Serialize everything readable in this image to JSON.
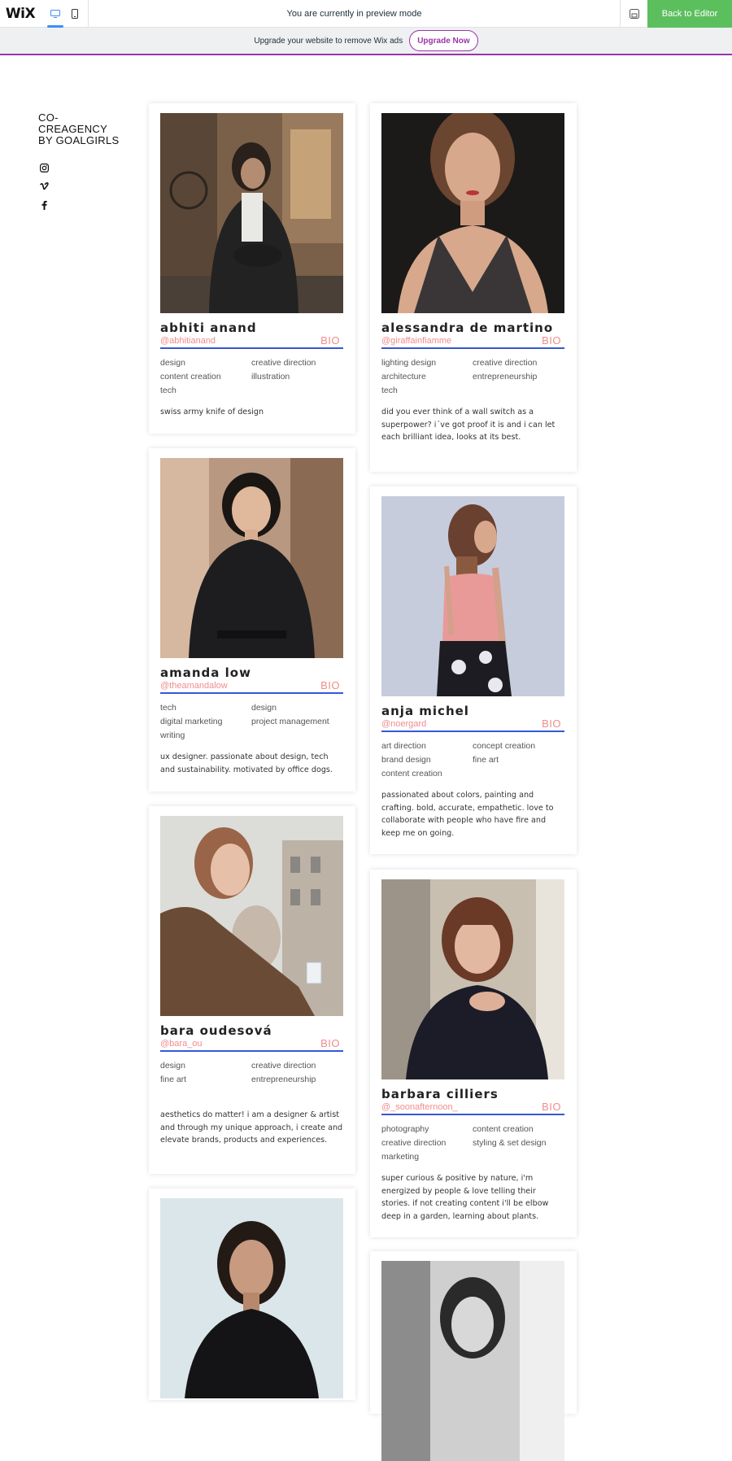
{
  "wix_bar": {
    "logo": "WiX",
    "preview_message": "You are currently in preview mode",
    "back_button": "Back to Editor",
    "upgrade_text": "Upgrade your website to remove Wix ads",
    "upgrade_button": "Upgrade Now",
    "colors": {
      "accent": "#9b35a8",
      "green": "#5cbf5e",
      "blue": "#3b8df7"
    }
  },
  "site": {
    "brand_lines": [
      "CO-",
      "CREAGENCY",
      "BY GOALGIRLS"
    ],
    "social_icons": [
      "instagram-icon",
      "vimeo-icon",
      "facebook-icon"
    ]
  },
  "colors": {
    "handle": "#f08c8c",
    "underline": "#3558d6"
  },
  "members": [
    {
      "name": "abhiti anand",
      "handle": "@abhitianand",
      "bio": "BIO",
      "tags": [
        "design",
        "creative direction",
        "content creation",
        "illustration",
        "tech"
      ],
      "description": "swiss army knife of design"
    },
    {
      "name": "alessandra de martino",
      "handle": "@giraffainfiamme",
      "bio": "BIO",
      "tags": [
        "lighting design",
        "creative direction",
        "architecture",
        "entrepreneurship",
        "tech"
      ],
      "description": "did you ever think of a wall switch as a superpower? i´ve got proof it is and i can let each brilliant idea, looks at its best."
    },
    {
      "name": "amanda low",
      "handle": "@theamandalow",
      "bio": "BIO",
      "tags": [
        "tech",
        "design",
        "digital marketing",
        "project management",
        "writing"
      ],
      "description": "ux designer. passionate about design, tech and sustainability. motivated by office dogs."
    },
    {
      "name": "anja michel",
      "handle": "@noergard",
      "bio": "BIO",
      "tags": [
        "art direction",
        "concept creation",
        "brand design",
        "fine art",
        "content creation"
      ],
      "description": "passionated about colors, painting and crafting. bold, accurate, empathetic. love to collaborate with people who have fire and keep me on going."
    },
    {
      "name": "bara oudesová",
      "handle": "@bara_ou",
      "bio": "BIO",
      "tags": [
        "design",
        "creative direction",
        "fine art",
        "entrepreneurship"
      ],
      "description": "aesthetics do matter! i am a designer & artist and through my unique approach, i create and elevate brands, products and experiences."
    },
    {
      "name": "barbara cilliers",
      "handle": "@_soonafternoon_",
      "bio": "BIO",
      "tags": [
        "photography",
        "content creation",
        "creative direction",
        "styling & set design",
        "marketing"
      ],
      "description": "super curious & positive by nature, i'm energized by people & love telling their stories. if not creating content i'll be elbow deep in a garden, learning about plants."
    }
  ]
}
